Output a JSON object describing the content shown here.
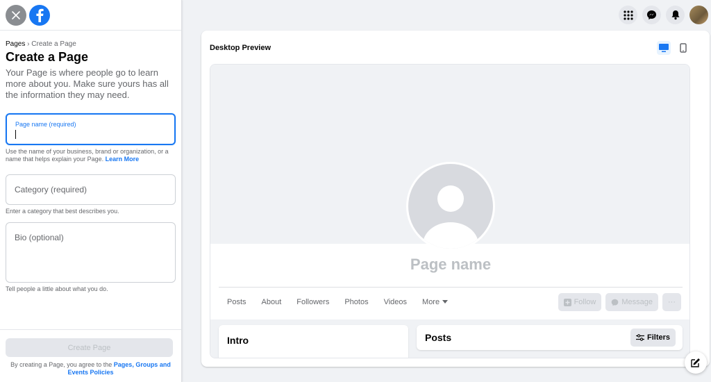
{
  "breadcrumb": {
    "root": "Pages",
    "separator": "›",
    "current": "Create a Page"
  },
  "sidebar": {
    "title": "Create a Page",
    "description": "Your Page is where people go to learn more about you. Make sure yours has all the information they may need.",
    "page_name": {
      "label": "Page name (required)",
      "value": ""
    },
    "page_name_hint": "Use the name of your business, brand or organization, or a name that helps explain your Page.",
    "learn_more": "Learn More",
    "category": {
      "placeholder": "Category (required)"
    },
    "category_hint": "Enter a category that best describes you.",
    "bio": {
      "placeholder": "Bio (optional)"
    },
    "bio_hint": "Tell people a little about what you do.",
    "create_button": "Create Page",
    "terms_prefix": "By creating a Page, you agree to the",
    "terms_link": "Pages, Groups and Events Policies"
  },
  "header_icons": [
    "menu-grid-icon",
    "messenger-icon",
    "notifications-bell-icon",
    "avatar"
  ],
  "preview": {
    "title": "Desktop Preview",
    "page_name_placeholder": "Page name",
    "tabs": [
      "Posts",
      "About",
      "Followers",
      "Photos",
      "Videos",
      "More"
    ],
    "actions": {
      "follow": "Follow",
      "message": "Message",
      "more": "···"
    },
    "intro_title": "Intro",
    "posts_title": "Posts",
    "filters": "Filters"
  },
  "colors": {
    "accent": "#1877f2",
    "background": "#f0f2f5",
    "disabled": "#e4e6eb"
  }
}
